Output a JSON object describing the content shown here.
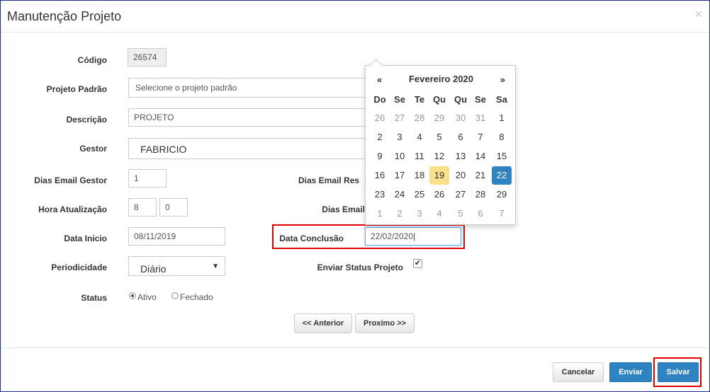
{
  "dialog": {
    "title": "Manutenção Projeto",
    "close_glyph": "×"
  },
  "form": {
    "codigo": {
      "label": "Código",
      "value": "26574"
    },
    "projeto_padrao": {
      "label": "Projeto Padrão",
      "value": "Selecione o projeto padrão"
    },
    "descricao": {
      "label": "Descrição",
      "value": "PROJETO"
    },
    "gestor": {
      "label": "Gestor",
      "value": "FABRICIO"
    },
    "dias_email_gestor": {
      "label": "Dias Email Gestor",
      "value": "1"
    },
    "dias_email_res": {
      "label": "Dias Email Res"
    },
    "hora_atualizacao": {
      "label": "Hora Atualização",
      "hour": "8",
      "minute": "0"
    },
    "dias_email": {
      "label": "Dias Email"
    },
    "data_inicio": {
      "label": "Data Inicio",
      "value": "08/11/2019"
    },
    "data_conclusao": {
      "label": "Data Conclusão",
      "value": "22/02/2020"
    },
    "periodicidade": {
      "label": "Periodicidade",
      "value": "Diário",
      "caret": "▼"
    },
    "enviar_status": {
      "label": "Enviar Status Projeto",
      "checked": true,
      "check_glyph": "✔"
    },
    "status": {
      "label": "Status",
      "options": [
        "Ativo",
        "Fechado"
      ],
      "selected": "Ativo"
    }
  },
  "navigation": {
    "prev_label": "<< Anterior",
    "next_label": "Proximo >>"
  },
  "footer": {
    "cancel_label": "Cancelar",
    "send_label": "Enviar",
    "save_label": "Salvar"
  },
  "datepicker": {
    "prev_glyph": "«",
    "next_glyph": "»",
    "month_label": "Fevereiro 2020",
    "weekdays": [
      "Do",
      "Se",
      "Te",
      "Qu",
      "Qu",
      "Se",
      "Sa"
    ],
    "weeks": [
      [
        "26",
        "27",
        "28",
        "29",
        "30",
        "31",
        "1"
      ],
      [
        "2",
        "3",
        "4",
        "5",
        "6",
        "7",
        "8"
      ],
      [
        "9",
        "10",
        "11",
        "12",
        "13",
        "14",
        "15"
      ],
      [
        "16",
        "17",
        "18",
        "19",
        "20",
        "21",
        "22"
      ],
      [
        "23",
        "24",
        "25",
        "26",
        "27",
        "28",
        "29"
      ],
      [
        "1",
        "2",
        "3",
        "4",
        "5",
        "6",
        "7"
      ]
    ],
    "today": "19",
    "selected": "22"
  },
  "colors": {
    "primary": "#2f83c1",
    "highlight": "#e00000",
    "today": "#fcdf8b"
  }
}
